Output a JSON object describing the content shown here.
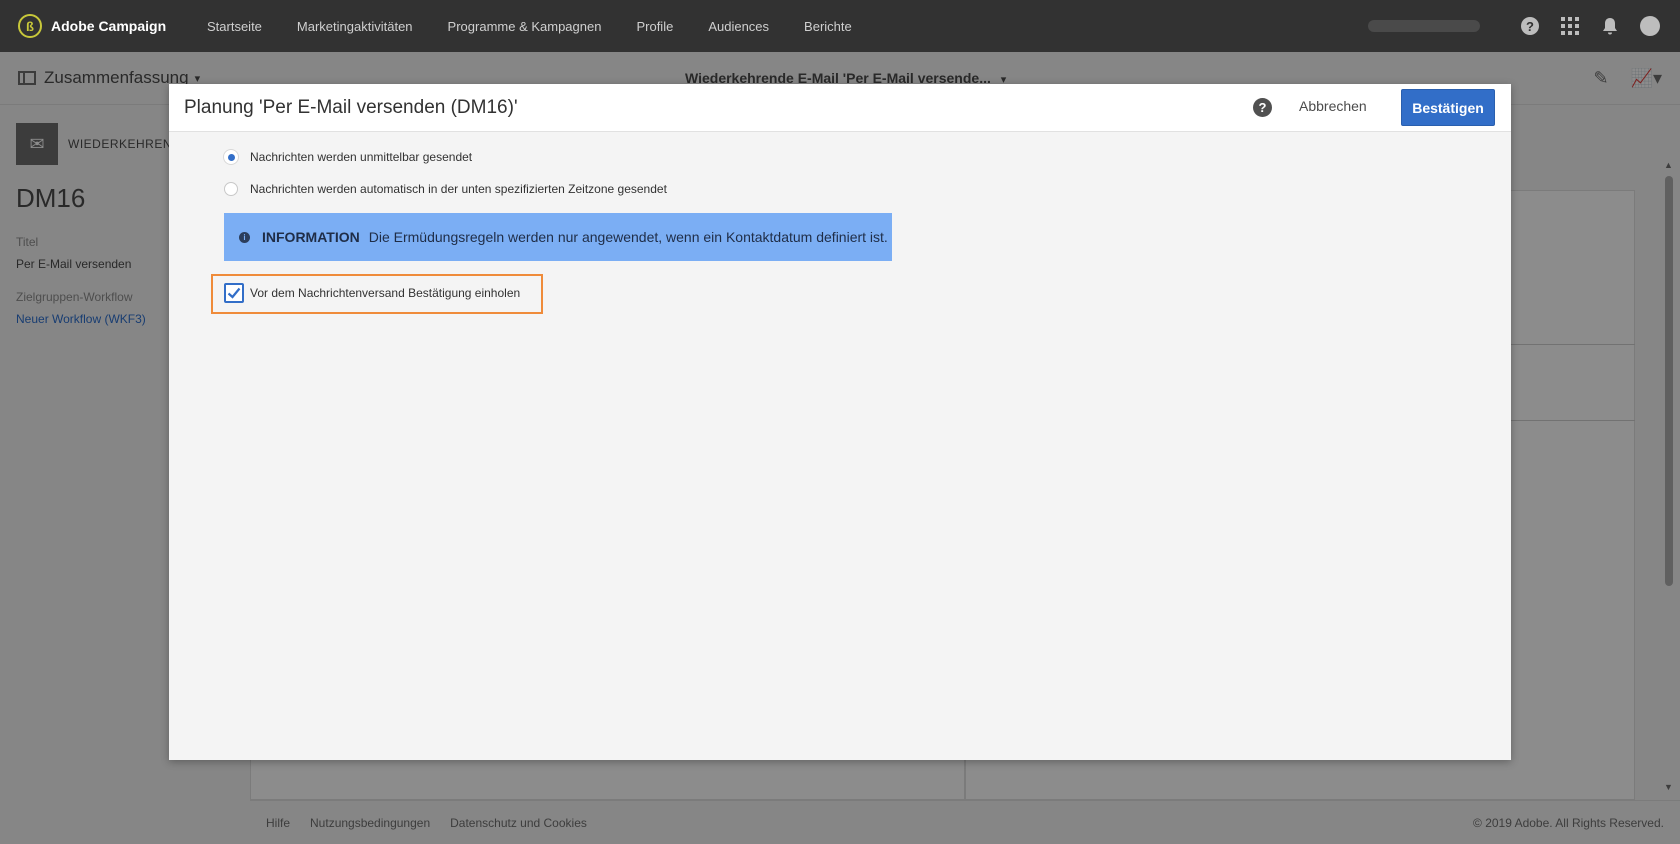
{
  "app": {
    "brand": "Adobe Campaign"
  },
  "nav": {
    "items": [
      "Startseite",
      "Marketingaktivitäten",
      "Programme & Kampagnen",
      "Profile",
      "Audiences",
      "Berichte"
    ]
  },
  "subbar": {
    "left_label": "Zusammenfassung",
    "center_title": "Wiederkehrende E-Mail 'Per E-Mail versende..."
  },
  "left_panel": {
    "badge_text": "WIEDERKEHREND",
    "id": "DM16",
    "title_label": "Titel",
    "title_value": "Per E-Mail versenden",
    "workflow_label": "Zielgruppen-Workflow",
    "workflow_value": "Neuer Workflow (WKF3)"
  },
  "footer": {
    "links": [
      "Hilfe",
      "Nutzungsbedingungen",
      "Datenschutz und Cookies"
    ],
    "copyright": "© 2019 Adobe. All Rights Reserved."
  },
  "modal": {
    "title": "Planung 'Per E-Mail versenden (DM16)'",
    "cancel_label": "Abbrechen",
    "confirm_label": "Bestätigen",
    "radio_options": [
      {
        "label": "Nachrichten werden unmittelbar gesendet",
        "selected": true
      },
      {
        "label": "Nachrichten werden automatisch in der unten spezifizierten Zeitzone gesendet",
        "selected": false
      }
    ],
    "info": {
      "title": "INFORMATION",
      "text": "Die Ermüdungsregeln werden nur angewendet, wenn ein Kontaktdatum definiert ist."
    },
    "checkbox": {
      "label": "Vor dem Nachrichtenversand Bestätigung einholen",
      "checked": true
    }
  },
  "colors": {
    "accent": "#326ec8",
    "info_bg": "#7baef4",
    "highlight_frame": "#ef8b3a",
    "topbar": "#323232"
  }
}
